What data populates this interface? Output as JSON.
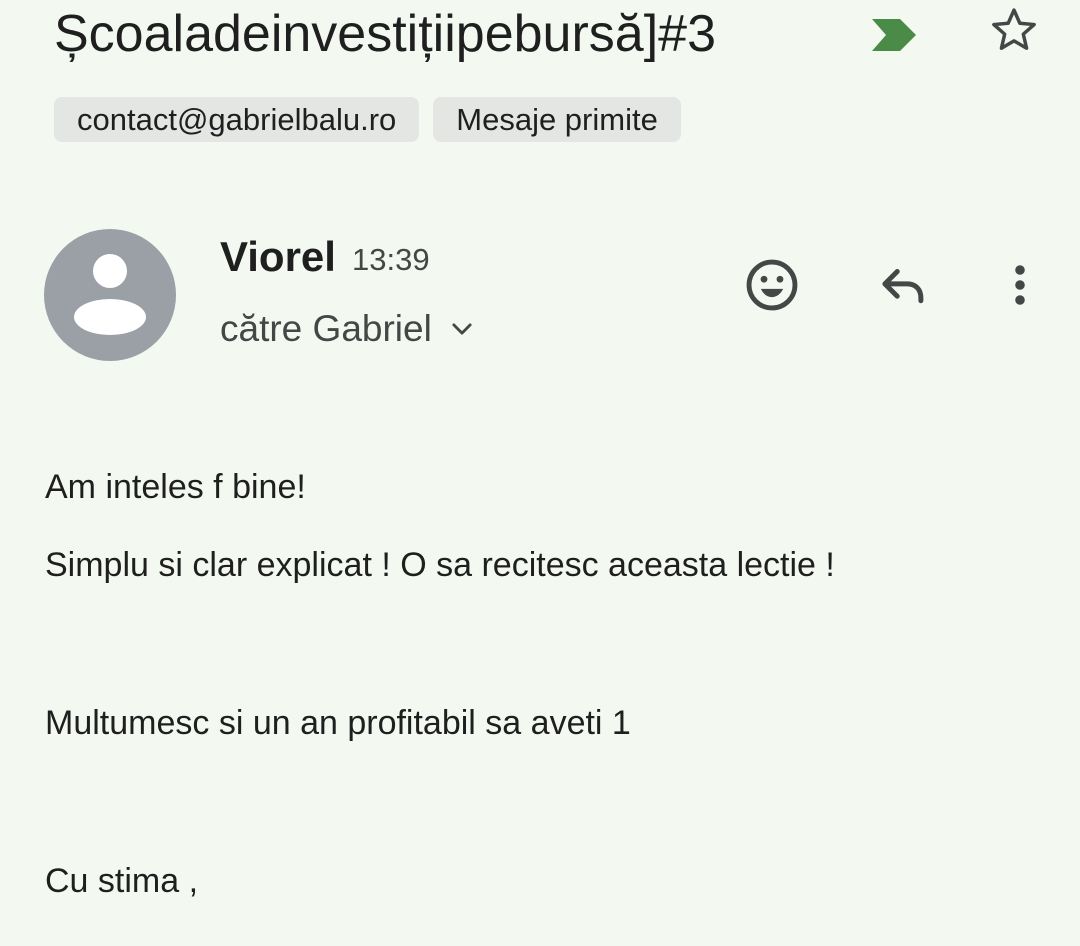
{
  "email": {
    "subject": "Școaladeinvestițiipebursă]#3",
    "labels": [
      "contact@gabrielbalu.ro",
      "Mesaje primite"
    ],
    "sender": {
      "name": "Viorel",
      "time": "13:39",
      "recipients": "către Gabriel"
    },
    "body": [
      "Am inteles f bine!",
      "Simplu si clar explicat ! O sa recitesc aceasta lectie !",
      "Multumesc si un an profitabil sa aveti 1",
      "Cu stima ,"
    ]
  },
  "icons": {
    "important": "important-marker-icon",
    "star": "star-outline-icon",
    "avatar": "person-avatar-icon",
    "expand": "chevron-down-icon",
    "emoji": "emoji-react-icon",
    "reply": "reply-arrow-icon",
    "more": "more-vert-icon"
  },
  "colors": {
    "background": "#f3f9f0",
    "text": "#1f1f1f",
    "secondary_text": "#444746",
    "chip_background": "#e3e6e2",
    "avatar_background": "#9aa0a6",
    "important_marker": "#4a8b48"
  }
}
